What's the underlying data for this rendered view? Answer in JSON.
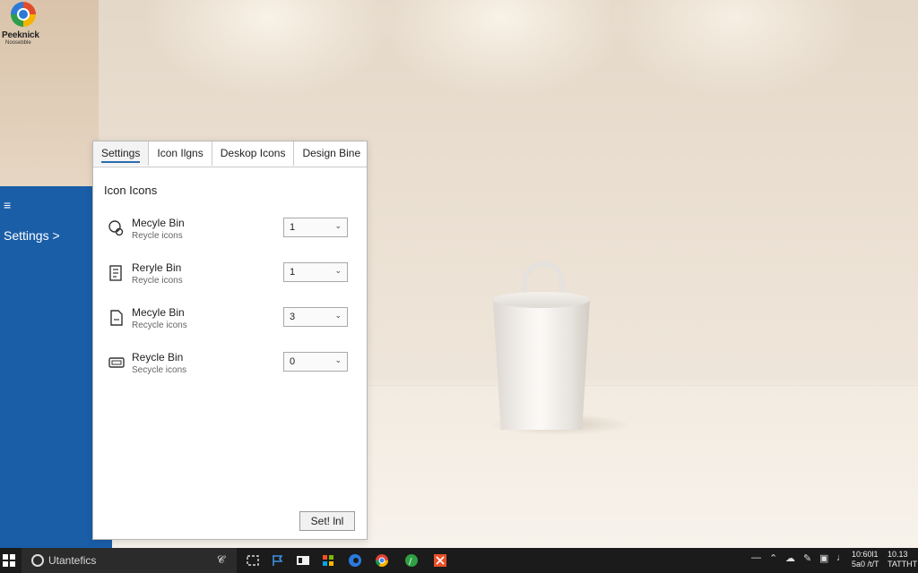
{
  "desktop": {
    "app_icon": {
      "name": "Peeknick",
      "subtitle": "Noosebble",
      "icon": "browser-logo-icon"
    }
  },
  "side_panel": {
    "menu_icon": "≡",
    "breadcrumb": "Settings >"
  },
  "dialog": {
    "tabs": [
      {
        "label": "Settings",
        "active": true
      },
      {
        "label": "Icon Ilgns",
        "active": false
      },
      {
        "label": "Deskop Icons",
        "active": false
      },
      {
        "label": "Design Bine",
        "active": false
      }
    ],
    "section_title": "Icon Icons",
    "rows": [
      {
        "title": "Mecyle Bin",
        "subtitle": "Reycle icons",
        "value": "1",
        "icon": "recycle-bin-icon"
      },
      {
        "title": "Reryle Bin",
        "subtitle": "Reycle icons",
        "value": "1",
        "icon": "document-bin-icon"
      },
      {
        "title": "Mecyle Bin",
        "subtitle": "Recycle icons",
        "value": "3",
        "icon": "file-icon"
      },
      {
        "title": "Reycle Bin",
        "subtitle": "Secycle icons",
        "value": "0",
        "icon": "drive-icon"
      }
    ],
    "set_button": "Set! lnl"
  },
  "taskbar": {
    "search_placeholder": "Utantefics",
    "clock_time": "10:60l1",
    "clock_date": "5a0 /t/T",
    "clock_time2": "10.13",
    "clock_date2": "TATTHT",
    "colors": {
      "taskbar": "#1b1b1b",
      "panel": "#1a5ea8"
    }
  }
}
